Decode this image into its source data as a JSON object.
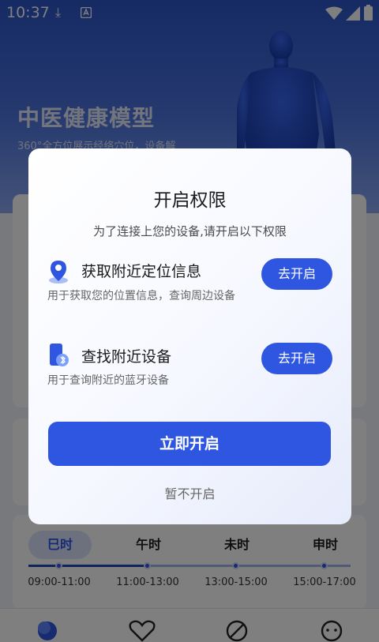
{
  "status_bar": {
    "time": "10:37"
  },
  "background": {
    "hero_title": "中医健康模型",
    "hero_subtitle": "360°全方位展示经络穴位，设备解",
    "time_tabs": [
      {
        "label": "巳时",
        "range": "09:00-11:00",
        "active": true
      },
      {
        "label": "午时",
        "range": "11:00-13:00",
        "active": false
      },
      {
        "label": "未时",
        "range": "13:00-15:00",
        "active": false
      },
      {
        "label": "申时",
        "range": "15:00-17:00",
        "active": false
      }
    ]
  },
  "dialog": {
    "title": "开启权限",
    "subtitle": "为了连接上您的设备,请开启以下权限",
    "permissions": [
      {
        "icon": "location-pin-icon",
        "title": "获取附近定位信息",
        "description": "用于获取您的位置信息，查询周边设备",
        "button_label": "去开启"
      },
      {
        "icon": "bluetooth-phone-icon",
        "title": "查找附近设备",
        "description": "用于查询附近的蓝牙设备",
        "button_label": "去开启"
      }
    ],
    "primary_button": "立即开启",
    "secondary_button": "暂不开启"
  },
  "colors": {
    "accent": "#2e56e0",
    "overlay": "rgba(0,0,0,0.5)"
  }
}
